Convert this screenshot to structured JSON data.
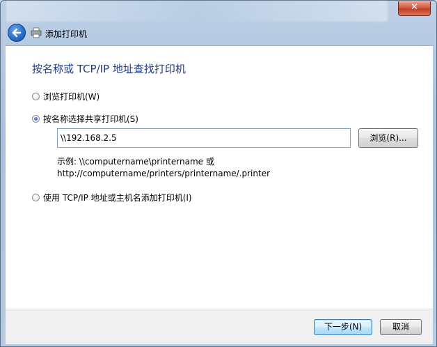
{
  "window": {
    "close_glyph": "✕",
    "nav_title": "添加打印机"
  },
  "content": {
    "heading": "按名称或 TCP/IP 地址查找打印机",
    "options": [
      {
        "label": "浏览打印机(W)",
        "checked": false
      },
      {
        "label": "按名称选择共享打印机(S)",
        "checked": true
      },
      {
        "label": "使用 TCP/IP 地址或主机名添加打印机(I)",
        "checked": false
      }
    ],
    "path_input": {
      "value": "\\\\192.168.2.5"
    },
    "browse_label": "浏览(R)...",
    "example_line1": "示例: \\\\computername\\printername 或",
    "example_line2": "http://computername/printers/printername/.printer"
  },
  "footer": {
    "next_label": "下一步(N)",
    "cancel_label": "取消"
  },
  "icons": {
    "back": "back-arrow-icon",
    "printer": "printer-icon",
    "close": "close-icon"
  },
  "colors": {
    "heading": "#1e3a8a",
    "close": "#c13f25",
    "back": "#2c6fc9"
  }
}
